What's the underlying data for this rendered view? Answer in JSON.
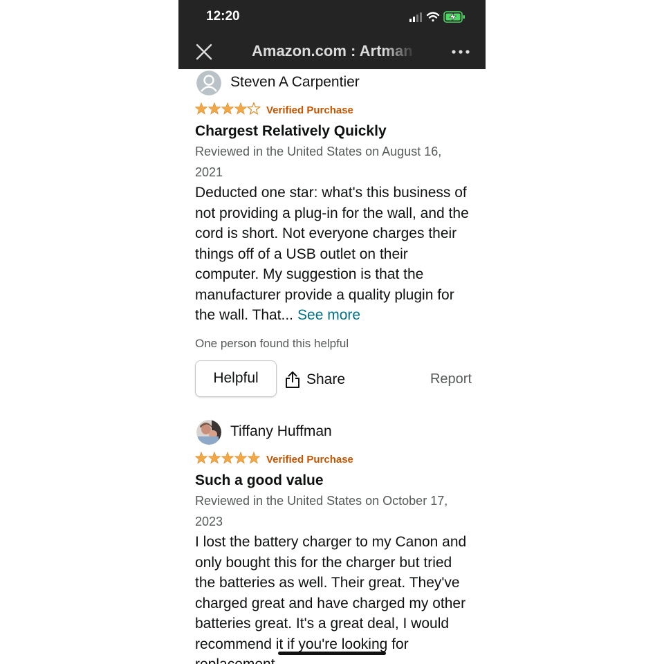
{
  "status_bar": {
    "time": "12:20"
  },
  "header": {
    "title": "Amazon.com : Artman"
  },
  "reviews": [
    {
      "name": "Steven A Carpentier",
      "rating": 4,
      "verified": "Verified Purchase",
      "title": "Chargest Relatively Quickly",
      "date": "Reviewed in the United States on August 16, 2021",
      "body": "Deducted one star: what's this business of not providing a plug-in for the wall, and the cord is short. Not everyone charges their things off of a USB outlet on their computer. My suggestion is that the manufacturer provide a quality plugin for the wall. That...",
      "see_more": "See more",
      "helpful_count": "One person found this helpful",
      "helpful_label": "Helpful",
      "share_label": "Share",
      "report_label": "Report"
    },
    {
      "name": "Tiffany Huffman",
      "rating": 5,
      "verified": "Verified Purchase",
      "title": "Such a good value",
      "date": "Reviewed in the United States on October 17, 2023",
      "body": "I lost the battery charger to my Canon and only bought this for the charger but tried the batteries as well. Their great. They've charged great and have charged my other batteries great. It's a great deal, I would recommend it if you're looking for replacement"
    }
  ],
  "colors": {
    "star": "#f3a847",
    "verified": "#c45500",
    "link": "#007185",
    "header_bg": "#242424"
  }
}
